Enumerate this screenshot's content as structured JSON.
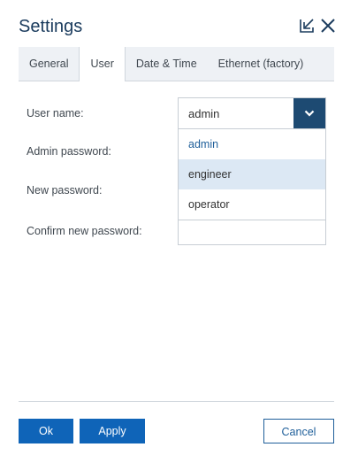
{
  "window": {
    "title": "Settings"
  },
  "tabs": [
    {
      "label": "General"
    },
    {
      "label": "User"
    },
    {
      "label": "Date & Time"
    },
    {
      "label": "Ethernet (factory)"
    }
  ],
  "active_tab": "User",
  "form": {
    "user_name_label": "User name:",
    "admin_password_label": "Admin password:",
    "new_password_label": "New password:",
    "confirm_password_label": "Confirm new password:",
    "user_name_value": "admin",
    "confirm_password_value": ""
  },
  "dropdown": {
    "options": [
      "admin",
      "engineer",
      "operator"
    ],
    "selected": "admin",
    "highlighted": "engineer"
  },
  "buttons": {
    "ok_label": "Ok",
    "apply_label": "Apply",
    "cancel_label": "Cancel"
  },
  "icons": {
    "minimize": "minimize-arrow-icon",
    "close": "close-icon",
    "dropdown": "chevron-down-icon"
  },
  "colors": {
    "title": "#1a3b5d",
    "primary_button": "#0f64b8",
    "select_button": "#1d4a72",
    "highlight": "#dce8f4",
    "selected_text": "#1f5f9a"
  }
}
